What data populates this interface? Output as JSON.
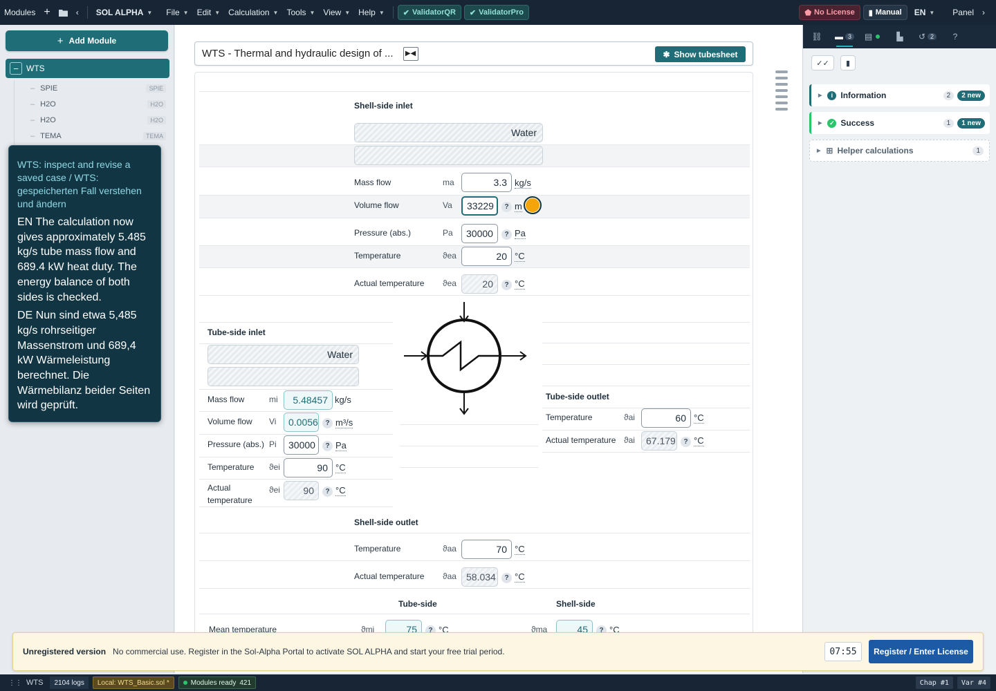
{
  "topbar": {
    "modules_label": "Modules",
    "app_name": "SOL ALPHA",
    "menu": [
      "File",
      "Edit",
      "Calculation",
      "Tools",
      "View",
      "Help"
    ],
    "validators": [
      "ValidatorQR",
      "ValidatorPro"
    ],
    "license": "No License",
    "manual": "Manual",
    "language": "EN",
    "panel": "Panel"
  },
  "sidebar": {
    "add_module": "Add Module",
    "root": "WTS",
    "items": [
      {
        "label": "SPIE",
        "tag": "SPIE"
      },
      {
        "label": "H2O",
        "tag": "H2O"
      },
      {
        "label": "H2O",
        "tag": "H2O"
      },
      {
        "label": "TEMA",
        "tag": "TEMA"
      }
    ]
  },
  "tooltip": {
    "title": "WTS: inspect and revise a saved case / WTS: gespeicherten Fall verstehen und ändern",
    "en": "EN The calculation now gives approximately 5.485 kg/s tube mass flow and 689.4 kW heat duty. The energy balance of both sides is checked.",
    "de": "DE Nun sind etwa 5,485 kg/s rohrseitiger Massenstrom und 689,4 kW Wärmeleistung berechnet. Die Wärmebilanz beider Seiten wird geprüft."
  },
  "header": {
    "title": "WTS - Thermal and hydraulic design of ...",
    "show_tubesheet": "Show tubesheet"
  },
  "shell_inlet": {
    "title": "Shell-side inlet",
    "medium": "Water",
    "mass_flow": {
      "label": "Mass flow",
      "sym": "ma",
      "value": "3.3",
      "unit": "kg/s"
    },
    "volume_flow": {
      "label": "Volume flow",
      "sym": "Va",
      "value": "33229",
      "unit": "m"
    },
    "pressure": {
      "label": "Pressure (abs.)",
      "sym": "Pa",
      "value": "30000",
      "unit": "Pa"
    },
    "temperature": {
      "label": "Temperature",
      "sym": "ϑea",
      "value": "20",
      "unit": "°C"
    },
    "actual_temperature": {
      "label": "Actual temperature",
      "sym": "ϑea",
      "value": "20",
      "unit": "°C"
    }
  },
  "tube_inlet": {
    "title": "Tube-side inlet",
    "medium": "Water",
    "mass_flow": {
      "label": "Mass flow",
      "sym": "mi",
      "value": "5.48457",
      "unit": "kg/s"
    },
    "volume_flow": {
      "label": "Volume flow",
      "sym": "Vi",
      "value": "0.0056",
      "unit": "m³/s"
    },
    "pressure": {
      "label": "Pressure (abs.)",
      "sym": "Pi",
      "value": "30000",
      "unit": "Pa"
    },
    "temperature": {
      "label": "Temperature",
      "sym": "ϑei",
      "value": "90",
      "unit": "°C"
    },
    "actual_temperature": {
      "label": "Actual temperature",
      "sym": "ϑei",
      "value": "90",
      "unit": "°C"
    }
  },
  "tube_outlet": {
    "title": "Tube-side outlet",
    "temperature": {
      "label": "Temperature",
      "sym": "ϑai",
      "value": "60",
      "unit": "°C"
    },
    "actual_temperature": {
      "label": "Actual temperature",
      "sym": "ϑai",
      "value": "67.179",
      "unit": "°C"
    }
  },
  "shell_outlet": {
    "title": "Shell-side outlet",
    "temperature": {
      "label": "Temperature",
      "sym": "ϑaa",
      "value": "70",
      "unit": "°C"
    },
    "actual_temperature": {
      "label": "Actual temperature",
      "sym": "ϑaa",
      "value": "58.034",
      "unit": "°C"
    }
  },
  "mean": {
    "tube_head": "Tube-side",
    "shell_head": "Shell-side",
    "label": "Mean temperature",
    "tube_sym": "ϑmi",
    "tube_value": "75",
    "shell_sym": "ϑma",
    "shell_value": "45",
    "unit": "°C"
  },
  "right_panel": {
    "tab_counts": {
      "messages": "3",
      "history": "2"
    },
    "cards": [
      {
        "label": "Information",
        "count": "2",
        "badge": "2 new",
        "color": "#1f6d77"
      },
      {
        "label": "Success",
        "count": "1",
        "badge": "1 new",
        "color": "#2ac46b"
      },
      {
        "label": "Helper calculations",
        "count": "1"
      }
    ]
  },
  "banner": {
    "title": "Unregistered version",
    "message": "No commercial use. Register in the Sol-Alpha Portal to activate SOL ALPHA and start your free trial period.",
    "timer": "07:55",
    "register": "Register / Enter License"
  },
  "statusbar": {
    "module": "WTS",
    "logs": "2104 logs",
    "local": "Local: WTS_Basic.sol *",
    "ready": "Modules ready",
    "ready_count": "421",
    "chap": "Chap #1",
    "var": "Var #4"
  }
}
